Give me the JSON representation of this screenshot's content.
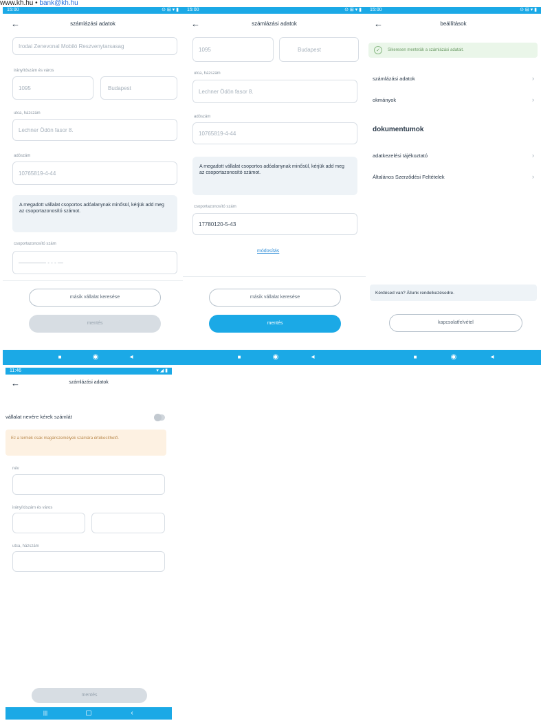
{
  "topline": {
    "site": "www.kh.hu",
    "sep": " • ",
    "email": "bank@kh.hu"
  },
  "status": {
    "time": "15:00",
    "icons": "⊙ ⊞ ▾ ▮"
  },
  "status4": {
    "time": "11:46",
    "icons": "▾ ◢ ▮"
  },
  "screen1": {
    "title": "számlázási adatok",
    "company_value": "Irodai Zenevonal Mobiló Reszvenytarsasag",
    "zip_label": "irányítószám és város",
    "zip_value": "1095",
    "city_value": "Budapest",
    "street_label": "utca, házszám",
    "street_value": "Lechner Ödön fasor 8.",
    "tax_label": "adószám",
    "tax_value": "10765819-4-44",
    "info_text": "A megadott vállalat csoportos adóalanynak minősül, kérjük add meg az csoportazonosító számot.",
    "group_label": "csoportazonosító szám",
    "group_placeholder": "————— - - - —",
    "other_company_btn": "másik vállalat keresése",
    "save_btn": "mentés"
  },
  "screen2": {
    "title": "számlázási adatok",
    "zip_value": "1095",
    "city_value": "Budapest",
    "street_label": "utca, házszám",
    "street_value": "Lechner Ödön fasor 8.",
    "tax_label": "adószám",
    "tax_value": "10765819-4-44",
    "info_text": "A megadott vállalat csoportos adóalanynak minősül, kérjük add meg az csoportazonosító számot.",
    "group_label": "csoportazonosító szám",
    "group_value": "17780120-5-43",
    "edit_link": "módosítás",
    "other_company_btn": "másik vállalat keresése",
    "save_btn": "mentés"
  },
  "screen3": {
    "title": "beállítások",
    "success_text": "Sikeresen mentetük a számlázási adatait.",
    "rows": [
      "számlázási adatok",
      "okmányok"
    ],
    "docs_title": "dokumentumok",
    "doc_rows": [
      "adatkezelési tájékoztató",
      "Általános Szerződési Feltételek"
    ],
    "help_text": "Kérdésed van? Állunk rendelkezésedre.",
    "contact_btn": "kapcsolatfelvétel"
  },
  "screen4": {
    "title": "számlázási adatok",
    "toggle_label": "vállalat nevére kérek számlát",
    "warning_text": "Ez a termék csak magánszemélyek számára értékesíthető.",
    "name_label": "név",
    "zip_label": "irányítószám és város",
    "street_label": "utca, házszám",
    "save_btn": "mentés"
  },
  "nav": {
    "square": "■",
    "circle": "◉",
    "back": "◂"
  },
  "nav4": {
    "recent": "|||",
    "home": "▢",
    "back": "‹"
  }
}
